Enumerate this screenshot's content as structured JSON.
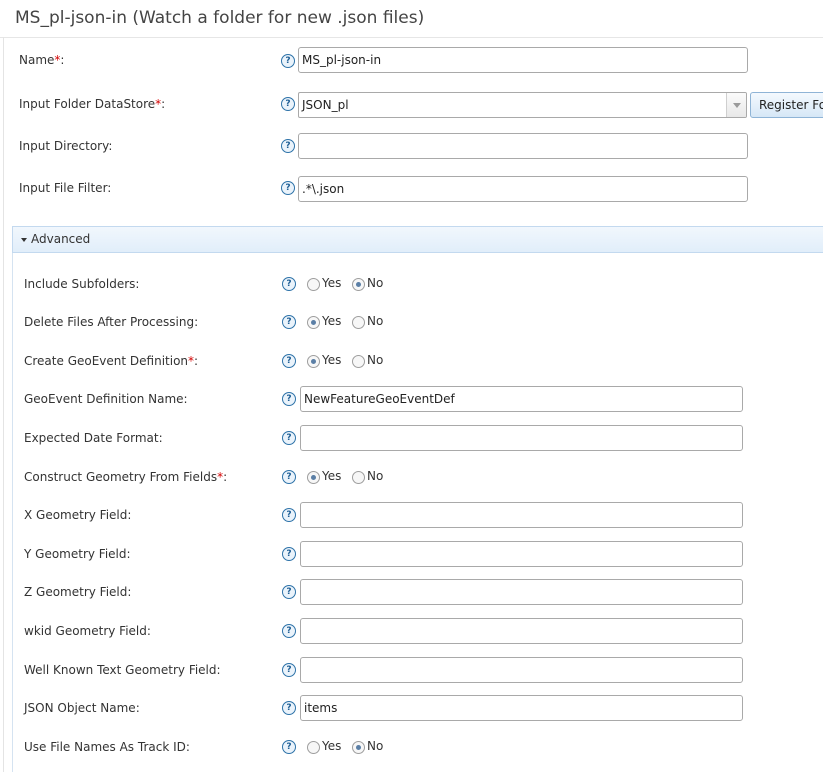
{
  "header": {
    "title": "MS_pl-json-in (Watch a folder for new .json files)"
  },
  "required_mark": "*",
  "help_glyph": "?",
  "main_fields": {
    "name": {
      "label": "Name",
      "required": true,
      "value": "MS_pl-json-in"
    },
    "input_folder_datastore": {
      "label": "Input Folder DataStore",
      "required": true,
      "value": "JSON_pl",
      "button": "Register Folder"
    },
    "input_directory": {
      "label": "Input Directory:",
      "value": ""
    },
    "input_file_filter": {
      "label": "Input File Filter:",
      "value": ".*\\.json"
    }
  },
  "advanced": {
    "label": "Advanced",
    "include_subfolders": {
      "label": "Include Subfolders:",
      "selected": "No"
    },
    "delete_files_after_processing": {
      "label": "Delete Files After Processing:",
      "selected": "Yes"
    },
    "create_geoevent_definition": {
      "label": "Create GeoEvent Definition",
      "required": true,
      "selected": "Yes"
    },
    "geoevent_definition_name": {
      "label": "GeoEvent Definition Name:",
      "value": "NewFeatureGeoEventDef"
    },
    "expected_date_format": {
      "label": "Expected Date Format:",
      "value": ""
    },
    "construct_geometry_from_fields": {
      "label": "Construct Geometry From Fields",
      "required": true,
      "selected": "Yes"
    },
    "x_geometry_field": {
      "label": "X Geometry Field:",
      "value": ""
    },
    "y_geometry_field": {
      "label": "Y Geometry Field:",
      "value": ""
    },
    "z_geometry_field": {
      "label": "Z Geometry Field:",
      "value": ""
    },
    "wkid_geometry_field": {
      "label": "wkid Geometry Field:",
      "value": ""
    },
    "wkt_geometry_field": {
      "label": "Well Known Text Geometry Field:",
      "value": ""
    },
    "json_object_name": {
      "label": "JSON Object Name:",
      "value": "items"
    },
    "use_file_names_as_track_id": {
      "label": "Use File Names As Track ID:",
      "selected": "No"
    }
  },
  "options": {
    "yes": "Yes",
    "no": "No"
  },
  "colors": {
    "required": "#d40000",
    "help": "#2d72a8",
    "advanced_bar": "#e1eefa"
  }
}
